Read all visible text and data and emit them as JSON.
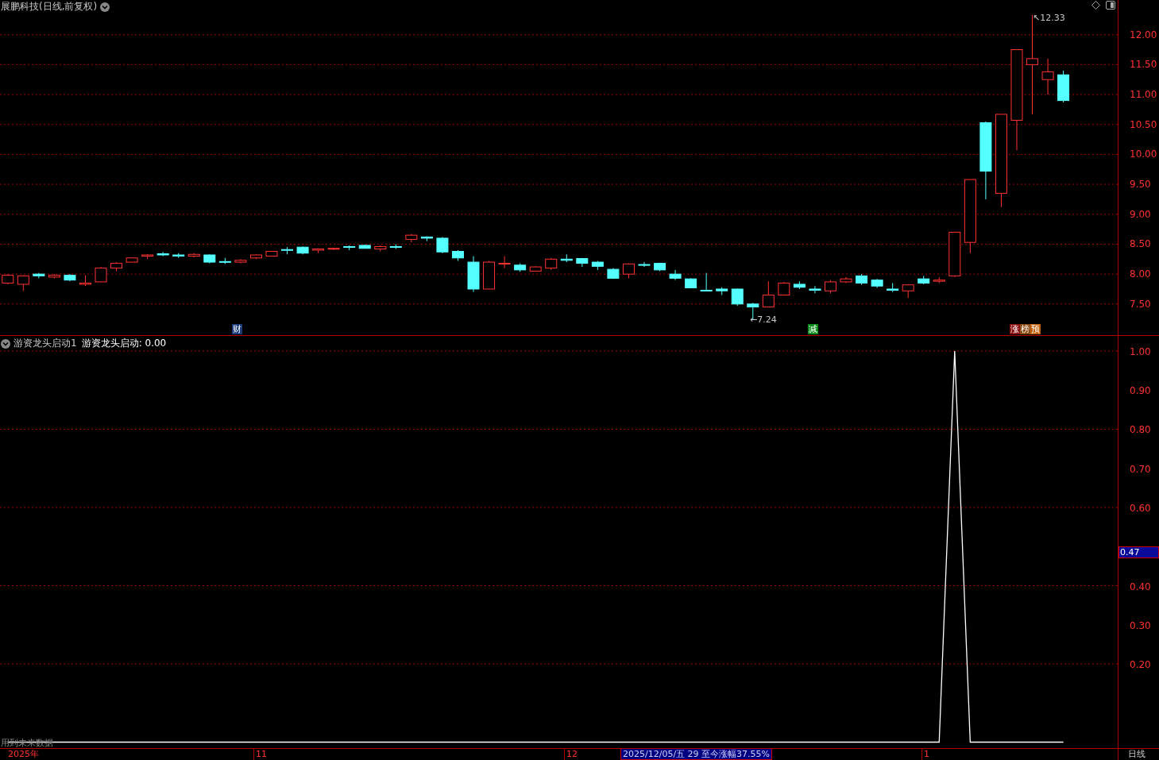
{
  "title": "展鹏科技(日线,前复权)",
  "price_chart": {
    "chart_data": {
      "type": "candlestick",
      "categories": [
        null,
        null,
        null,
        null,
        null,
        null,
        null,
        null,
        null,
        null,
        null,
        null,
        null,
        null,
        null,
        null,
        null,
        null,
        null,
        null,
        null,
        null,
        null,
        null,
        null,
        null,
        null,
        null,
        null,
        null,
        null,
        null,
        null,
        null,
        null,
        null,
        null,
        null,
        null,
        null,
        null,
        null,
        null,
        null,
        null,
        null,
        null,
        null,
        null,
        null,
        null,
        null,
        null,
        null,
        null,
        null,
        null,
        null,
        null,
        null,
        null,
        null,
        null,
        null,
        null,
        null,
        null,
        null,
        null,
        null,
        null,
        null
      ],
      "ohlc": [
        [
          7.85,
          8.0,
          7.83,
          7.98
        ],
        [
          7.83,
          7.98,
          7.72,
          7.97
        ],
        [
          8.0,
          8.02,
          7.93,
          7.97
        ],
        [
          7.95,
          8.0,
          7.93,
          7.98
        ],
        [
          7.98,
          8.0,
          7.88,
          7.9
        ],
        [
          7.83,
          7.98,
          7.8,
          7.85
        ],
        [
          7.87,
          8.12,
          7.87,
          8.1
        ],
        [
          8.1,
          8.2,
          8.05,
          8.18
        ],
        [
          8.2,
          8.28,
          8.2,
          8.27
        ],
        [
          8.3,
          8.33,
          8.25,
          8.32
        ],
        [
          8.34,
          8.37,
          8.3,
          8.32
        ],
        [
          8.32,
          8.35,
          8.27,
          8.3
        ],
        [
          8.3,
          8.35,
          8.28,
          8.33
        ],
        [
          8.32,
          8.33,
          8.18,
          8.2
        ],
        [
          8.21,
          8.27,
          8.17,
          8.2
        ],
        [
          8.2,
          8.25,
          8.18,
          8.23
        ],
        [
          8.27,
          8.33,
          8.25,
          8.32
        ],
        [
          8.3,
          8.38,
          8.3,
          8.38
        ],
        [
          8.41,
          8.45,
          8.33,
          8.4
        ],
        [
          8.45,
          8.46,
          8.33,
          8.35
        ],
        [
          8.4,
          8.43,
          8.35,
          8.42
        ],
        [
          8.42,
          8.44,
          8.4,
          8.43
        ],
        [
          8.46,
          8.48,
          8.4,
          8.45
        ],
        [
          8.48,
          8.49,
          8.43,
          8.43
        ],
        [
          8.42,
          8.48,
          8.38,
          8.46
        ],
        [
          8.46,
          8.5,
          8.42,
          8.45
        ],
        [
          8.58,
          8.67,
          8.53,
          8.65
        ],
        [
          8.62,
          8.63,
          8.55,
          8.6
        ],
        [
          8.6,
          8.62,
          8.35,
          8.37
        ],
        [
          8.38,
          8.4,
          8.22,
          8.27
        ],
        [
          8.2,
          8.3,
          7.7,
          7.75
        ],
        [
          7.75,
          8.22,
          7.75,
          8.2
        ],
        [
          8.17,
          8.3,
          8.1,
          8.18
        ],
        [
          8.15,
          8.18,
          8.04,
          8.07
        ],
        [
          8.05,
          8.13,
          8.05,
          8.12
        ],
        [
          8.1,
          8.27,
          8.07,
          8.25
        ],
        [
          8.25,
          8.33,
          8.2,
          8.23
        ],
        [
          8.26,
          8.27,
          8.12,
          8.18
        ],
        [
          8.2,
          8.22,
          8.07,
          8.13
        ],
        [
          8.08,
          8.1,
          7.92,
          7.93
        ],
        [
          8.0,
          8.18,
          7.93,
          8.17
        ],
        [
          8.16,
          8.2,
          8.12,
          8.15
        ],
        [
          8.18,
          8.19,
          8.05,
          8.07
        ],
        [
          8.0,
          8.07,
          7.9,
          7.93
        ],
        [
          7.92,
          7.93,
          7.77,
          7.77
        ],
        [
          7.73,
          8.02,
          7.72,
          7.72
        ],
        [
          7.75,
          7.78,
          7.65,
          7.72
        ],
        [
          7.75,
          7.76,
          7.47,
          7.5
        ],
        [
          7.5,
          7.52,
          7.24,
          7.45
        ],
        [
          7.45,
          7.88,
          7.45,
          7.65
        ],
        [
          7.65,
          7.87,
          7.65,
          7.85
        ],
        [
          7.83,
          7.88,
          7.75,
          7.78
        ],
        [
          7.75,
          7.8,
          7.68,
          7.73
        ],
        [
          7.72,
          7.9,
          7.68,
          7.87
        ],
        [
          7.87,
          7.95,
          7.85,
          7.92
        ],
        [
          7.97,
          8.0,
          7.82,
          7.85
        ],
        [
          7.9,
          7.92,
          7.77,
          7.8
        ],
        [
          7.75,
          7.85,
          7.7,
          7.73
        ],
        [
          7.72,
          7.83,
          7.6,
          7.82
        ],
        [
          7.92,
          7.97,
          7.83,
          7.85
        ],
        [
          7.88,
          7.95,
          7.85,
          7.9
        ],
        [
          7.97,
          8.7,
          7.95,
          8.7
        ],
        [
          8.53,
          9.58,
          8.35,
          9.58
        ],
        [
          10.53,
          10.55,
          9.25,
          9.72
        ],
        [
          9.35,
          10.67,
          9.12,
          10.67
        ],
        [
          10.57,
          11.75,
          10.07,
          11.75
        ],
        [
          11.5,
          12.33,
          10.67,
          11.6
        ],
        [
          11.25,
          11.6,
          11.0,
          11.38
        ],
        [
          11.33,
          11.4,
          10.87,
          10.9
        ],
        null,
        null,
        null
      ],
      "ylim": [
        6.98,
        12.58
      ],
      "grid": true,
      "yticks": [
        {
          "value": 12,
          "label": "12.00"
        },
        {
          "value": 11.5,
          "label": "11.50"
        },
        {
          "value": 11,
          "label": "11.00"
        },
        {
          "value": 10.5,
          "label": "10.50"
        },
        {
          "value": 10,
          "label": "10.00"
        },
        {
          "value": 9.5,
          "label": "9.50"
        },
        {
          "value": 9,
          "label": "9.00"
        },
        {
          "value": 8.5,
          "label": "8.50"
        },
        {
          "value": 8,
          "label": "8.00"
        },
        {
          "value": 7.5,
          "label": "7.50"
        }
      ]
    }
  },
  "high_label": "↖12.33",
  "low_label": "←7.24",
  "event_markers": [
    {
      "label": "财",
      "color": "#1a3a78"
    },
    {
      "label": "减",
      "color": "#0c8a1a"
    },
    {
      "label": "涨",
      "color": "#8a1010"
    },
    {
      "label": "榜",
      "color": "#8a4a10"
    },
    {
      "label": "预",
      "color": "#c0600a"
    }
  ],
  "indicator": {
    "name": "游资龙头启动1",
    "reading": ": 0.00",
    "warning": "用到未来数据",
    "current_tag": "0.47",
    "chart_data": {
      "type": "line",
      "ylim": [
        -0.0152,
        1.0406
      ],
      "grid": true,
      "categories": [
        null,
        null,
        null,
        null,
        null,
        null,
        null,
        null,
        null,
        null,
        null,
        null,
        null,
        null,
        null,
        null,
        null,
        null,
        null,
        null,
        null,
        null,
        null,
        null,
        null,
        null,
        null,
        null,
        null,
        null,
        null,
        null,
        null,
        null,
        null,
        null,
        null,
        null,
        null,
        null,
        null,
        null,
        null,
        null,
        null,
        null,
        null,
        null,
        null,
        null,
        null,
        null,
        null,
        null,
        null,
        null,
        null,
        null,
        null,
        null,
        null,
        null,
        null,
        null,
        null,
        null,
        null,
        null,
        null,
        null,
        null,
        null
      ],
      "series": [
        {
          "name": "游资龙头启动",
          "color": "#ffffff",
          "values": [
            0,
            0,
            0,
            0,
            0,
            0,
            0,
            0,
            0,
            0,
            0,
            0,
            0,
            0,
            0,
            0,
            0,
            0,
            0,
            0,
            0,
            0,
            0,
            0,
            0,
            0,
            0,
            0,
            0,
            0,
            0,
            0,
            0,
            0,
            0,
            0,
            0,
            0,
            0,
            0,
            0,
            0,
            0,
            0,
            0,
            0,
            0,
            0,
            0,
            0,
            0,
            0,
            0,
            0,
            0,
            0,
            0,
            0,
            0,
            0,
            0,
            1,
            0,
            0,
            0,
            0,
            0,
            0,
            0,
            null,
            null,
            null
          ]
        }
      ],
      "yticks": [
        {
          "value": 1,
          "label": "1.00"
        },
        {
          "value": 0.9,
          "label": "0.90"
        },
        {
          "value": 0.8,
          "label": "0.80"
        },
        {
          "value": 0.7,
          "label": "0.70"
        },
        {
          "value": 0.6,
          "label": "0.60"
        },
        {
          "value": 0.4,
          "label": "0.40"
        },
        {
          "value": 0.3,
          "label": "0.30"
        },
        {
          "value": 0.2,
          "label": "0.20"
        }
      ]
    }
  },
  "time_axis": [
    "2025年",
    "11",
    "12",
    "1"
  ],
  "range_info": "2025/12/05/五 29 至今涨幅37.55%",
  "period": "日线"
}
